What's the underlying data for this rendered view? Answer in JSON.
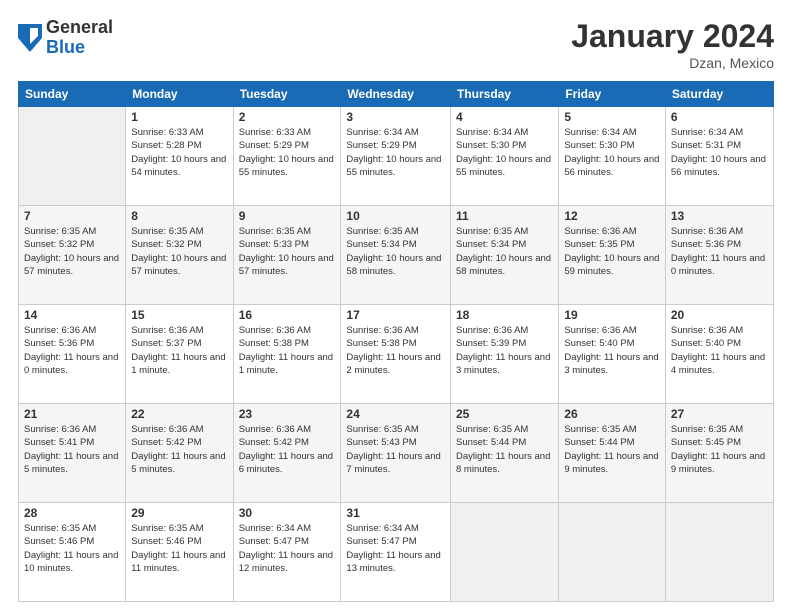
{
  "header": {
    "logo_general": "General",
    "logo_blue": "Blue",
    "month_title": "January 2024",
    "location": "Dzan, Mexico"
  },
  "weekdays": [
    "Sunday",
    "Monday",
    "Tuesday",
    "Wednesday",
    "Thursday",
    "Friday",
    "Saturday"
  ],
  "weeks": [
    [
      {
        "day": "",
        "sunrise": "",
        "sunset": "",
        "daylight": ""
      },
      {
        "day": "1",
        "sunrise": "Sunrise: 6:33 AM",
        "sunset": "Sunset: 5:28 PM",
        "daylight": "Daylight: 10 hours and 54 minutes."
      },
      {
        "day": "2",
        "sunrise": "Sunrise: 6:33 AM",
        "sunset": "Sunset: 5:29 PM",
        "daylight": "Daylight: 10 hours and 55 minutes."
      },
      {
        "day": "3",
        "sunrise": "Sunrise: 6:34 AM",
        "sunset": "Sunset: 5:29 PM",
        "daylight": "Daylight: 10 hours and 55 minutes."
      },
      {
        "day": "4",
        "sunrise": "Sunrise: 6:34 AM",
        "sunset": "Sunset: 5:30 PM",
        "daylight": "Daylight: 10 hours and 55 minutes."
      },
      {
        "day": "5",
        "sunrise": "Sunrise: 6:34 AM",
        "sunset": "Sunset: 5:30 PM",
        "daylight": "Daylight: 10 hours and 56 minutes."
      },
      {
        "day": "6",
        "sunrise": "Sunrise: 6:34 AM",
        "sunset": "Sunset: 5:31 PM",
        "daylight": "Daylight: 10 hours and 56 minutes."
      }
    ],
    [
      {
        "day": "7",
        "sunrise": "Sunrise: 6:35 AM",
        "sunset": "Sunset: 5:32 PM",
        "daylight": "Daylight: 10 hours and 57 minutes."
      },
      {
        "day": "8",
        "sunrise": "Sunrise: 6:35 AM",
        "sunset": "Sunset: 5:32 PM",
        "daylight": "Daylight: 10 hours and 57 minutes."
      },
      {
        "day": "9",
        "sunrise": "Sunrise: 6:35 AM",
        "sunset": "Sunset: 5:33 PM",
        "daylight": "Daylight: 10 hours and 57 minutes."
      },
      {
        "day": "10",
        "sunrise": "Sunrise: 6:35 AM",
        "sunset": "Sunset: 5:34 PM",
        "daylight": "Daylight: 10 hours and 58 minutes."
      },
      {
        "day": "11",
        "sunrise": "Sunrise: 6:35 AM",
        "sunset": "Sunset: 5:34 PM",
        "daylight": "Daylight: 10 hours and 58 minutes."
      },
      {
        "day": "12",
        "sunrise": "Sunrise: 6:36 AM",
        "sunset": "Sunset: 5:35 PM",
        "daylight": "Daylight: 10 hours and 59 minutes."
      },
      {
        "day": "13",
        "sunrise": "Sunrise: 6:36 AM",
        "sunset": "Sunset: 5:36 PM",
        "daylight": "Daylight: 11 hours and 0 minutes."
      }
    ],
    [
      {
        "day": "14",
        "sunrise": "Sunrise: 6:36 AM",
        "sunset": "Sunset: 5:36 PM",
        "daylight": "Daylight: 11 hours and 0 minutes."
      },
      {
        "day": "15",
        "sunrise": "Sunrise: 6:36 AM",
        "sunset": "Sunset: 5:37 PM",
        "daylight": "Daylight: 11 hours and 1 minute."
      },
      {
        "day": "16",
        "sunrise": "Sunrise: 6:36 AM",
        "sunset": "Sunset: 5:38 PM",
        "daylight": "Daylight: 11 hours and 1 minute."
      },
      {
        "day": "17",
        "sunrise": "Sunrise: 6:36 AM",
        "sunset": "Sunset: 5:38 PM",
        "daylight": "Daylight: 11 hours and 2 minutes."
      },
      {
        "day": "18",
        "sunrise": "Sunrise: 6:36 AM",
        "sunset": "Sunset: 5:39 PM",
        "daylight": "Daylight: 11 hours and 3 minutes."
      },
      {
        "day": "19",
        "sunrise": "Sunrise: 6:36 AM",
        "sunset": "Sunset: 5:40 PM",
        "daylight": "Daylight: 11 hours and 3 minutes."
      },
      {
        "day": "20",
        "sunrise": "Sunrise: 6:36 AM",
        "sunset": "Sunset: 5:40 PM",
        "daylight": "Daylight: 11 hours and 4 minutes."
      }
    ],
    [
      {
        "day": "21",
        "sunrise": "Sunrise: 6:36 AM",
        "sunset": "Sunset: 5:41 PM",
        "daylight": "Daylight: 11 hours and 5 minutes."
      },
      {
        "day": "22",
        "sunrise": "Sunrise: 6:36 AM",
        "sunset": "Sunset: 5:42 PM",
        "daylight": "Daylight: 11 hours and 5 minutes."
      },
      {
        "day": "23",
        "sunrise": "Sunrise: 6:36 AM",
        "sunset": "Sunset: 5:42 PM",
        "daylight": "Daylight: 11 hours and 6 minutes."
      },
      {
        "day": "24",
        "sunrise": "Sunrise: 6:35 AM",
        "sunset": "Sunset: 5:43 PM",
        "daylight": "Daylight: 11 hours and 7 minutes."
      },
      {
        "day": "25",
        "sunrise": "Sunrise: 6:35 AM",
        "sunset": "Sunset: 5:44 PM",
        "daylight": "Daylight: 11 hours and 8 minutes."
      },
      {
        "day": "26",
        "sunrise": "Sunrise: 6:35 AM",
        "sunset": "Sunset: 5:44 PM",
        "daylight": "Daylight: 11 hours and 9 minutes."
      },
      {
        "day": "27",
        "sunrise": "Sunrise: 6:35 AM",
        "sunset": "Sunset: 5:45 PM",
        "daylight": "Daylight: 11 hours and 9 minutes."
      }
    ],
    [
      {
        "day": "28",
        "sunrise": "Sunrise: 6:35 AM",
        "sunset": "Sunset: 5:46 PM",
        "daylight": "Daylight: 11 hours and 10 minutes."
      },
      {
        "day": "29",
        "sunrise": "Sunrise: 6:35 AM",
        "sunset": "Sunset: 5:46 PM",
        "daylight": "Daylight: 11 hours and 11 minutes."
      },
      {
        "day": "30",
        "sunrise": "Sunrise: 6:34 AM",
        "sunset": "Sunset: 5:47 PM",
        "daylight": "Daylight: 11 hours and 12 minutes."
      },
      {
        "day": "31",
        "sunrise": "Sunrise: 6:34 AM",
        "sunset": "Sunset: 5:47 PM",
        "daylight": "Daylight: 11 hours and 13 minutes."
      },
      {
        "day": "",
        "sunrise": "",
        "sunset": "",
        "daylight": ""
      },
      {
        "day": "",
        "sunrise": "",
        "sunset": "",
        "daylight": ""
      },
      {
        "day": "",
        "sunrise": "",
        "sunset": "",
        "daylight": ""
      }
    ]
  ]
}
